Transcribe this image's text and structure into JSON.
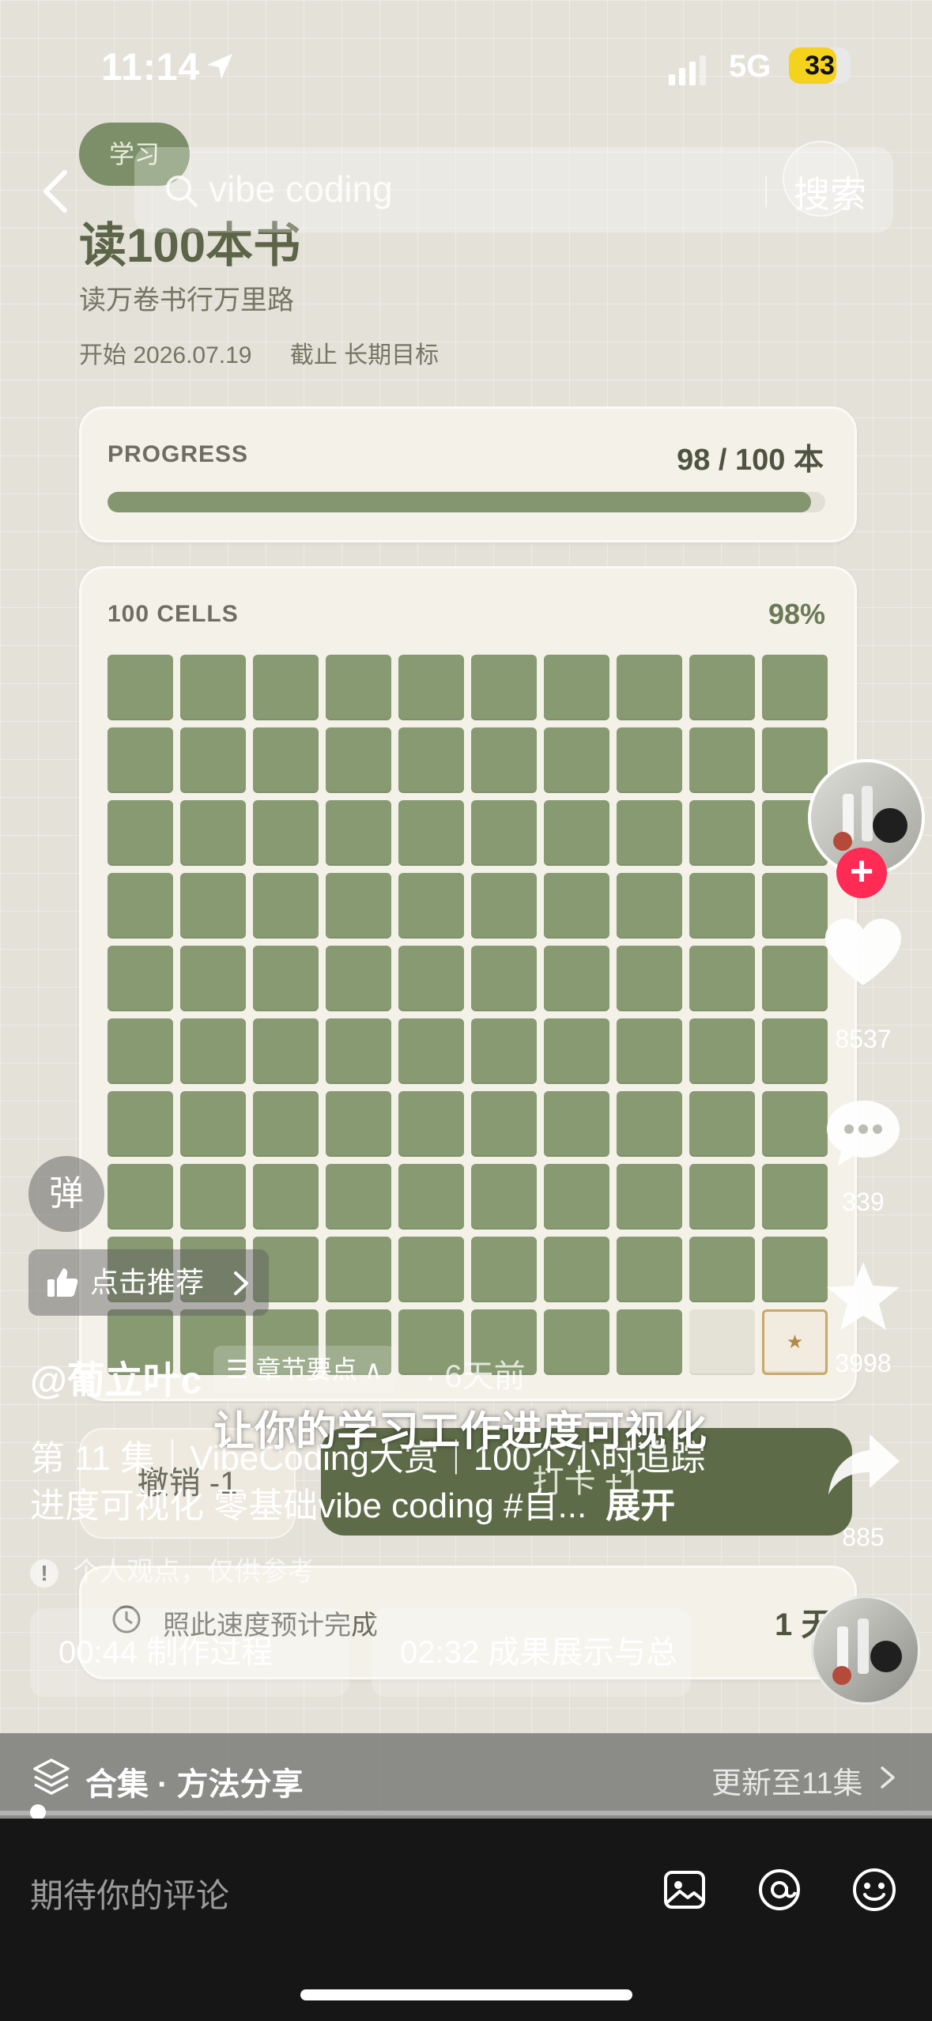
{
  "status_bar": {
    "time": "11:14",
    "network": "5G",
    "battery": "33"
  },
  "search": {
    "placeholder": "vibe coding",
    "button_label": "搜索"
  },
  "goal": {
    "tag": "学习",
    "title": "读100本书",
    "subtitle": "读万卷书行万里路",
    "start": "开始 2026.07.19",
    "deadline": "截止 长期目标"
  },
  "progress": {
    "label": "PROGRESS",
    "value_text": "98 / 100 本",
    "fraction": 0.98
  },
  "cells": {
    "label": "100 CELLS",
    "percent": "98%",
    "total": 100,
    "filled": 98,
    "star_symbol": "★"
  },
  "actions": {
    "undo_label": "撤销 -1",
    "checkin_label": "打卡 +1"
  },
  "eta": {
    "text": "照此速度预计完成",
    "days": "1 天"
  },
  "rail": {
    "likes": "8537",
    "comments": "339",
    "favorites": "3998",
    "shares": "885",
    "follow_symbol": "+"
  },
  "overlay": {
    "danmaku_label": "弹",
    "recommend_label": "点击推荐",
    "author": "@葡立叶c",
    "chapter_chip": "☰ 章节要点 ∧",
    "posted": "· 6天前",
    "subtitle_caption": "让你的学习工作进度可视化",
    "description_line1": "第 11 集｜VibeCoding大赏｜100个小时追踪",
    "description_line2": "进度可视化 零基础vibe coding #自...",
    "expand_label": "展开",
    "disclaimer": "个人观点，仅供参考",
    "disclaimer_icon": "!",
    "chapters": [
      "00:44 制作过程",
      "02:32 成果展示与总"
    ]
  },
  "collection": {
    "label": "合集 · 方法分享",
    "update": "更新至11集"
  },
  "comment": {
    "placeholder": "期待你的评论"
  },
  "colors": {
    "accent_green": "#849670",
    "dark_green": "#5d6b48",
    "like_red": "#fe2c55"
  }
}
